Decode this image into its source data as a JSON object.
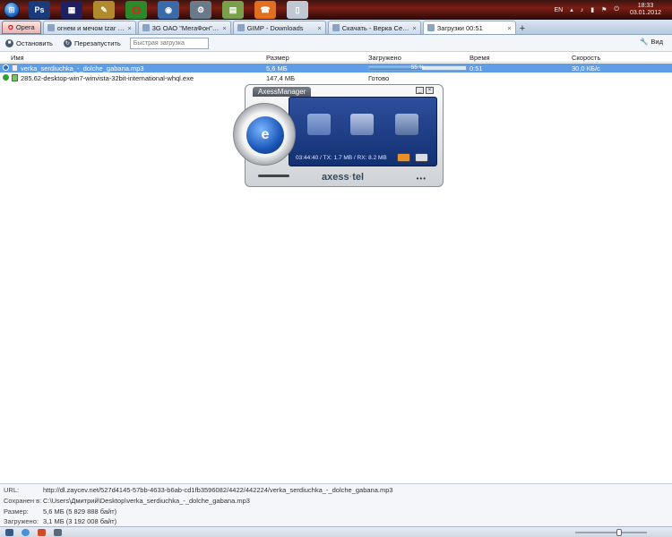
{
  "taskbar": {
    "tray_lang": "EN",
    "clock_time": "18:33",
    "clock_date": "03.01.2012"
  },
  "tabs": {
    "opera_label": "Opera",
    "items": [
      {
        "label": "огнем и мечом tzar —..."
      },
      {
        "label": "3G ОАО \"МегаФон\" - ..."
      },
      {
        "label": "GIMP - Downloads"
      },
      {
        "label": "Скачать - Верка Серд..."
      },
      {
        "label": "Загрузки 00:51"
      }
    ]
  },
  "toolbar": {
    "stop_label": "Остановить",
    "restart_label": "Перезапустить",
    "quick_placeholder": "Быстрая загрузка",
    "view_label": "Вид"
  },
  "columns": {
    "name": "Имя",
    "size": "Размер",
    "downloaded": "Загружено",
    "time": "Время",
    "speed": "Скорость"
  },
  "downloads": [
    {
      "name": "verka_serdiuchka_-_dolche_gabana.mp3",
      "size": "5,6 МБ",
      "progress_text": "55 %",
      "progress": 0.55,
      "time": "0:51",
      "speed": "30,0 КБ/с"
    },
    {
      "name": "285.62-desktop-win7-winvista-32bit-international-whql.exe",
      "size": "147,4 МБ",
      "status": "Готово"
    }
  ],
  "axess": {
    "title": "AxessManager",
    "stats": "03:44:40 / TX: 1.7 MB / RX: 8.2 MB",
    "brand_left": "axess",
    "brand_right": "tel",
    "logo_letter": "e"
  },
  "details": {
    "url_label": "URL:",
    "url": "http://dl.zaycev.net/527d4145-57bb-4633-b6ab-cd1fb3596082/4422/442224/verka_serdiuchka_-_dolche_gabana.mp3",
    "saved_label": "Сохранен в:",
    "saved": "C:\\Users\\Дмитрий\\Desktop\\verka_serdiuchka_-_dolche_gabana.mp3",
    "size_label": "Размер:",
    "size": "5,6 МБ (5 829 888 байт)",
    "loaded_label": "Загружено:",
    "loaded": "3,1 МБ (3 192 008 байт)"
  },
  "colors": {
    "selection": "#5f9ee6",
    "taskbar": "#7a1d14"
  }
}
